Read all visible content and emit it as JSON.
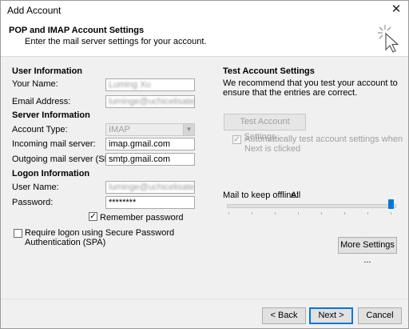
{
  "window": {
    "title": "Add Account",
    "close_glyph": "✕"
  },
  "header": {
    "title": "POP and IMAP Account Settings",
    "subtitle": "Enter the mail server settings for your account.",
    "icon": "cursor-click-icon"
  },
  "user_info": {
    "heading": "User Information",
    "your_name_label": "Your Name:",
    "your_name_value": "Luming Xu",
    "email_label": "Email Address:",
    "email_value": "luminge@uchicelisatemc.com"
  },
  "server_info": {
    "heading": "Server Information",
    "account_type_label": "Account Type:",
    "account_type_value": "IMAP",
    "incoming_label": "Incoming mail server:",
    "incoming_value": "imap.gmail.com",
    "outgoing_label": "Outgoing mail server (SMTP):",
    "outgoing_value": "smtp.gmail.com"
  },
  "logon_info": {
    "heading": "Logon Information",
    "username_label": "User Name:",
    "username_value": "luminge@uchicelisatemc.co",
    "password_label": "Password:",
    "password_value": "********",
    "remember_label": "Remember password",
    "remember_checked": true,
    "spa_label": "Require logon using Secure Password Authentication (SPA)",
    "spa_checked": false
  },
  "test_settings": {
    "heading": "Test Account Settings",
    "description": "We recommend that you test your account to ensure that the entries are correct.",
    "test_button": "Test Account Settings ...",
    "auto_test_label": "Automatically test account settings when Next is clicked",
    "auto_test_checked": true
  },
  "offline": {
    "label": "Mail to keep offline:",
    "value": "All",
    "slider_level": 1.0
  },
  "more_settings_button": "More Settings ...",
  "footer": {
    "back_button": "< Back",
    "next_button": "Next >",
    "cancel_button": "Cancel"
  }
}
